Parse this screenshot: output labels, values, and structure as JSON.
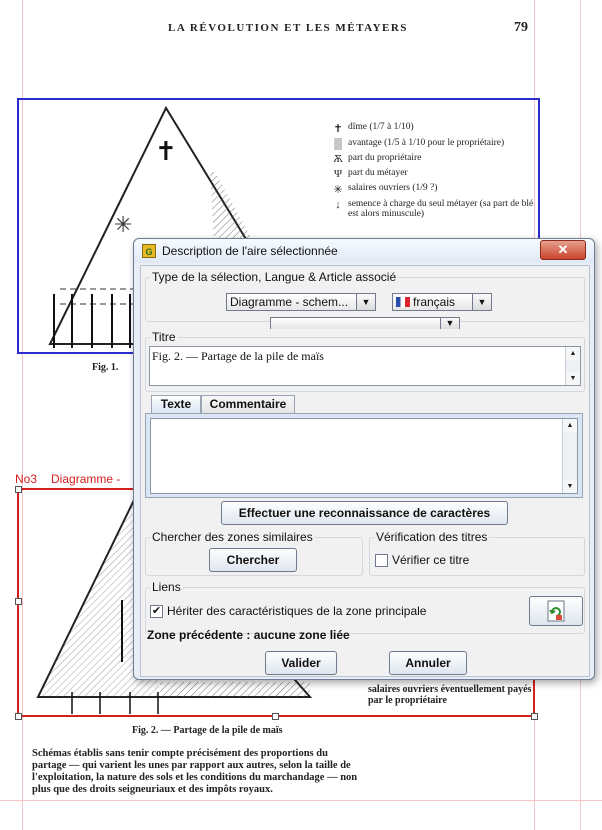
{
  "page": {
    "running_title": "LA RÉVOLUTION ET LES MÉTAYERS",
    "page_number": "79",
    "fig1_caption": "Fig. 1.",
    "fig2_caption": "Fig. 2. — Partage de la pile de maïs",
    "zone3_label": {
      "number": "No3",
      "type": "Diagramme -"
    },
    "legend": [
      {
        "icon": "cross-icon",
        "glyph": "✝",
        "text": "dîme (1/7 à 1/10)"
      },
      {
        "icon": "hatched-icon",
        "glyph": "▒",
        "text": "avantage (1/5 à 1/10 pour le propriétaire)"
      },
      {
        "icon": "owner-icon",
        "glyph": "Ѫ",
        "text": "part du propriétaire"
      },
      {
        "icon": "pitchfork-icon",
        "glyph": "Ψ",
        "text": "part du métayer"
      },
      {
        "icon": "star-icon",
        "glyph": "✳",
        "text": "salaires ouvriers (1/9 ?)"
      },
      {
        "icon": "arrow-down-icon",
        "glyph": "↓",
        "text": "semence à charge du seul métayer (sa part de blé est alors minuscule)"
      }
    ],
    "bottom_legend": "salaires ouvriers éventuellement payés par le propriétaire",
    "body_text": "Schémas établis sans tenir compte précisément des proportions du partage — qui varient les unes par rapport aux autres, selon la taille de l'exploitation, la nature des sols et les conditions du marchandage — non plus que des droits seigneuriaux et des impôts royaux."
  },
  "dialog": {
    "title": "Description de l'aire sélectionnée",
    "close_glyph": "✕",
    "app_icon_glyph": "G",
    "section_type": "Type de la sélection, Langue & Article associé",
    "type_combo": "Diagramme - schem...",
    "lang_combo": "français",
    "section_titre": "Titre",
    "titre_value": "Fig. 2. — Partage de la pile de maïs",
    "tab_texte": "Texte",
    "tab_commentaire": "Commentaire",
    "ocr_button": "Effectuer une reconnaissance de caractères",
    "section_similar": "Chercher des zones similaires",
    "search_button": "Chercher",
    "section_verif": "Vérification des titres",
    "verif_checkbox": "Vérifier ce titre",
    "section_liens": "Liens",
    "inherit_checkbox": "Hériter des caractéristiques de la zone principale",
    "prev_zone": "Zone précédente : aucune zone liée",
    "validate_button": "Valider",
    "cancel_button": "Annuler",
    "arrow_glyph": "▼",
    "up_glyph": "▲",
    "check_glyph": "✔"
  }
}
